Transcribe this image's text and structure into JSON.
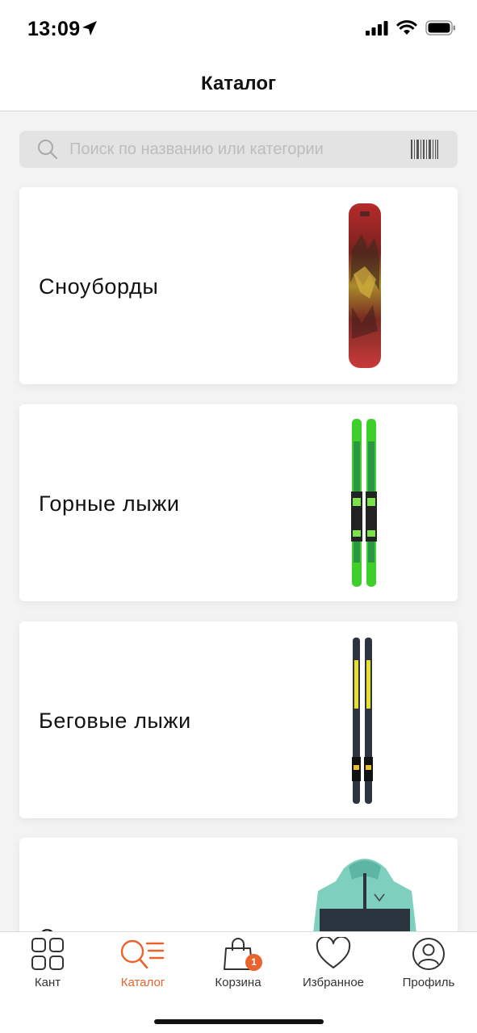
{
  "status_bar": {
    "time": "13:09"
  },
  "header": {
    "title": "Каталог"
  },
  "search": {
    "placeholder": "Поиск по названию или категории",
    "value": ""
  },
  "categories": [
    {
      "label": "Сноуборды",
      "image_icon": "snowboard-image"
    },
    {
      "label": "Горные лыжи",
      "image_icon": "alpine-skis-image"
    },
    {
      "label": "Беговые лыжи",
      "image_icon": "cross-country-skis-image"
    },
    {
      "label": "С",
      "image_icon": "jacket-image"
    }
  ],
  "tab_bar": {
    "tabs": [
      {
        "label": "Кант",
        "icon": "grid-icon",
        "active": false
      },
      {
        "label": "Каталог",
        "icon": "catalog-search-icon",
        "active": true
      },
      {
        "label": "Корзина",
        "icon": "shopping-bag-icon",
        "badge": "1",
        "active": false
      },
      {
        "label": "Избранное",
        "icon": "heart-icon",
        "active": false
      },
      {
        "label": "Профиль",
        "icon": "profile-icon",
        "active": false
      }
    ]
  },
  "colors": {
    "accent": "#e8642c",
    "background": "#f3f3f3",
    "card": "#ffffff",
    "search_bg": "#e3e3e3"
  }
}
